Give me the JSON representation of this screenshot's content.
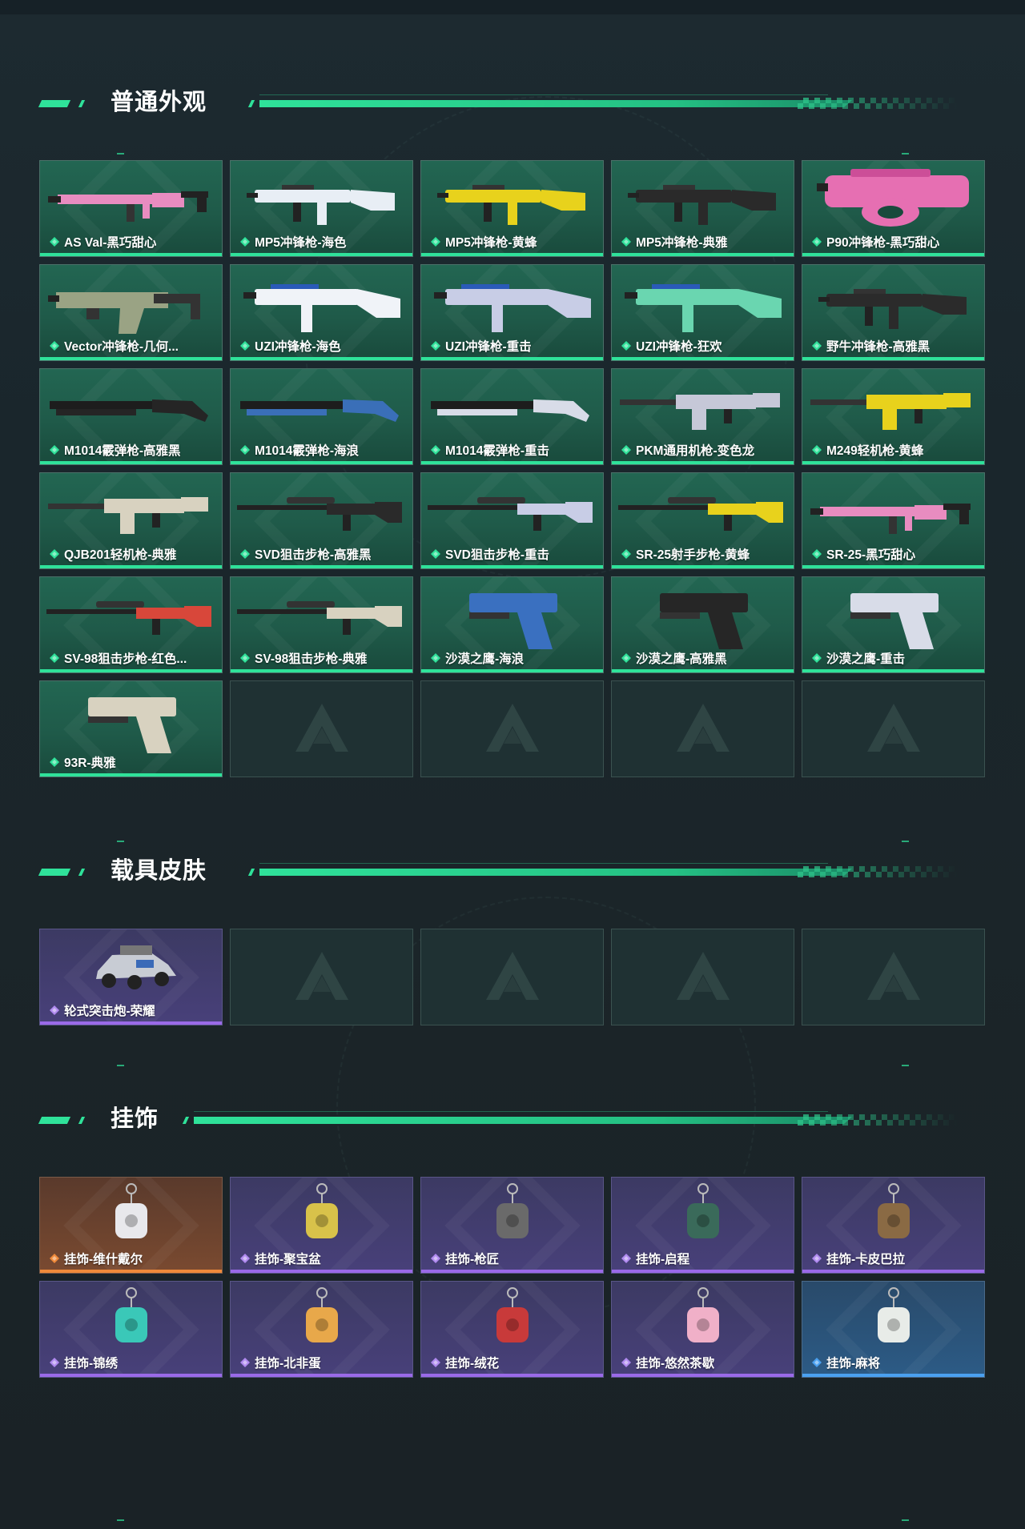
{
  "colors": {
    "accent": "#2fe29a",
    "purple_rarity": "#9a6ae8",
    "orange_rarity": "#f08a3a",
    "blue_rarity": "#4aa0f0"
  },
  "sections": [
    {
      "title": "普通外观",
      "items": [
        {
          "name": "AS Val-黑巧甜心",
          "rarity": "green",
          "icon": "rifle-icon",
          "color": "#e88cc0"
        },
        {
          "name": "MP5冲锋枪-海色",
          "rarity": "green",
          "icon": "smg-icon",
          "color": "#e8eef5"
        },
        {
          "name": "MP5冲锋枪-黄蜂",
          "rarity": "green",
          "icon": "smg-icon",
          "color": "#e8d21c"
        },
        {
          "name": "MP5冲锋枪-典雅",
          "rarity": "green",
          "icon": "smg-icon",
          "color": "#2a2a2a"
        },
        {
          "name": "P90冲锋枪-黑巧甜心",
          "rarity": "green",
          "icon": "p90-icon",
          "color": "#e66fb2"
        },
        {
          "name": "Vector冲锋枪-几何...",
          "rarity": "green",
          "icon": "vector-icon",
          "color": "#9aa384"
        },
        {
          "name": "UZI冲锋枪-海色",
          "rarity": "green",
          "icon": "uzi-icon",
          "color": "#f0f3f8"
        },
        {
          "name": "UZI冲锋枪-重击",
          "rarity": "green",
          "icon": "uzi-icon",
          "color": "#c8cde6"
        },
        {
          "name": "UZI冲锋枪-狂欢",
          "rarity": "green",
          "icon": "uzi-icon",
          "color": "#6ad6b0"
        },
        {
          "name": "野牛冲锋枪-高雅黑",
          "rarity": "green",
          "icon": "smg-icon",
          "color": "#2b2b2b"
        },
        {
          "name": "M1014霰弹枪-高雅黑",
          "rarity": "green",
          "icon": "shotgun-icon",
          "color": "#252525"
        },
        {
          "name": "M1014霰弹枪-海浪",
          "rarity": "green",
          "icon": "shotgun-icon",
          "color": "#3a6fb8"
        },
        {
          "name": "M1014霰弹枪-重击",
          "rarity": "green",
          "icon": "shotgun-icon",
          "color": "#d8dce8"
        },
        {
          "name": "PKM通用机枪-变色龙",
          "rarity": "green",
          "icon": "lmg-icon",
          "color": "#c6c8d8"
        },
        {
          "name": "M249轻机枪-黄蜂",
          "rarity": "green",
          "icon": "lmg-icon",
          "color": "#e8d21c"
        },
        {
          "name": "QJB201轻机枪-典雅",
          "rarity": "green",
          "icon": "lmg-icon",
          "color": "#d8d2c0"
        },
        {
          "name": "SVD狙击步枪-高雅黑",
          "rarity": "green",
          "icon": "sniper-icon",
          "color": "#2a2a2a"
        },
        {
          "name": "SVD狙击步枪-重击",
          "rarity": "green",
          "icon": "sniper-icon",
          "color": "#c8cde6"
        },
        {
          "name": "SR-25射手步枪-黄蜂",
          "rarity": "green",
          "icon": "sniper-icon",
          "color": "#e8d21c"
        },
        {
          "name": "SR-25-黑巧甜心",
          "rarity": "green",
          "icon": "rifle-icon",
          "color": "#e88cc0"
        },
        {
          "name": "SV-98狙击步枪-红色...",
          "rarity": "green",
          "icon": "sniper-icon",
          "color": "#d8473a"
        },
        {
          "name": "SV-98狙击步枪-典雅",
          "rarity": "green",
          "icon": "sniper-icon",
          "color": "#d8d2c0"
        },
        {
          "name": "沙漠之鹰-海浪",
          "rarity": "green",
          "icon": "pistol-icon",
          "color": "#3a70c0"
        },
        {
          "name": "沙漠之鹰-高雅黑",
          "rarity": "green",
          "icon": "pistol-icon",
          "color": "#262626"
        },
        {
          "name": "沙漠之鹰-重击",
          "rarity": "green",
          "icon": "pistol-icon",
          "color": "#d8dce8"
        },
        {
          "name": "93R-典雅",
          "rarity": "green",
          "icon": "pistol-icon",
          "color": "#d8d2c0"
        }
      ],
      "empty_slots": 4
    },
    {
      "title": "载具皮肤",
      "items": [
        {
          "name": "轮式突击炮-荣耀",
          "rarity": "purple",
          "icon": "vehicle-icon",
          "color": "#c8ccd4"
        }
      ],
      "empty_slots": 4
    },
    {
      "title": "挂饰",
      "items": [
        {
          "name": "挂饰-维什戴尔",
          "rarity": "orange",
          "icon": "charm-icon",
          "color": "#e8e8ec"
        },
        {
          "name": "挂饰-聚宝盆",
          "rarity": "purple",
          "icon": "charm-icon",
          "color": "#d8c24a"
        },
        {
          "name": "挂饰-枪匠",
          "rarity": "purple",
          "icon": "charm-icon",
          "color": "#6a6a6a"
        },
        {
          "name": "挂饰-启程",
          "rarity": "purple",
          "icon": "charm-icon",
          "color": "#3a6a5a"
        },
        {
          "name": "挂饰-卡皮巴拉",
          "rarity": "purple",
          "icon": "charm-icon",
          "color": "#8a6a44"
        },
        {
          "name": "挂饰-锦绣",
          "rarity": "purple",
          "icon": "charm-icon",
          "color": "#3ac8b8"
        },
        {
          "name": "挂饰-北非蛋",
          "rarity": "purple",
          "icon": "charm-icon",
          "color": "#e8a84a"
        },
        {
          "name": "挂饰-绒花",
          "rarity": "purple",
          "icon": "charm-icon",
          "color": "#c83a3a"
        },
        {
          "name": "挂饰-悠然茶歇",
          "rarity": "purple",
          "icon": "charm-icon",
          "color": "#f0b0c8"
        },
        {
          "name": "挂饰-麻将",
          "rarity": "blue",
          "icon": "charm-icon",
          "color": "#e8ece8"
        }
      ],
      "empty_slots": 0
    }
  ]
}
